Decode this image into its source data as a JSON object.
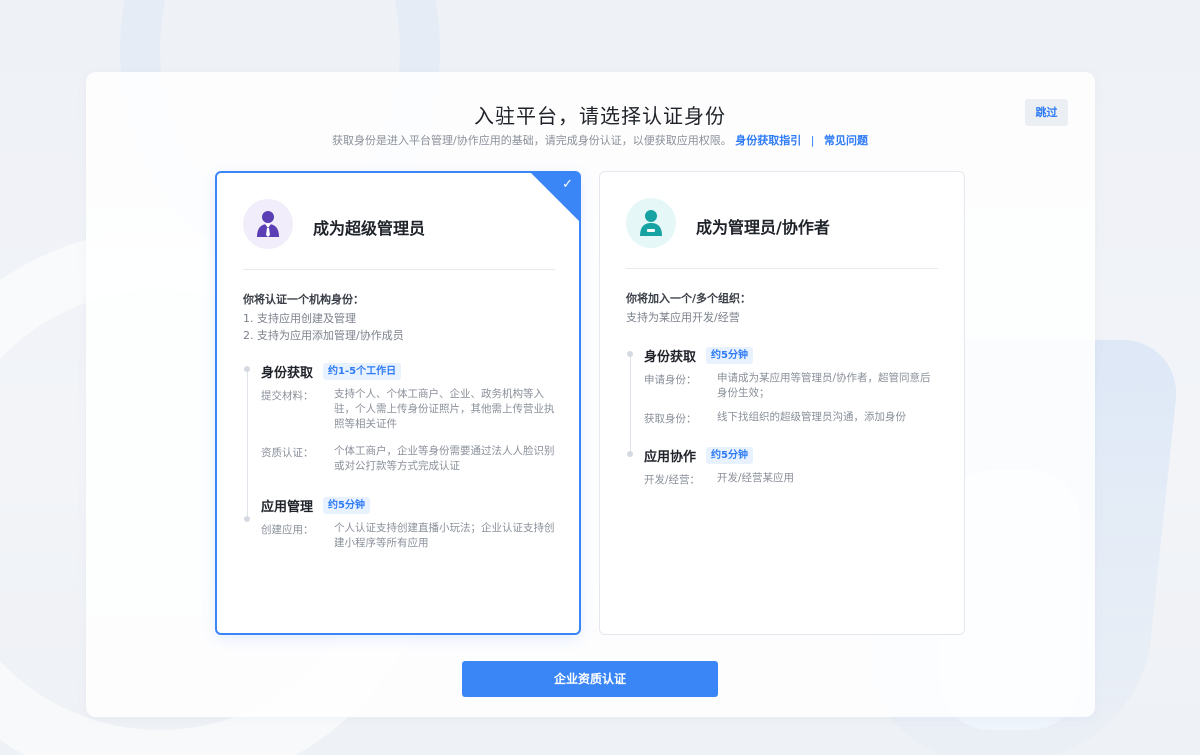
{
  "header": {
    "title": "入驻平台，请选择认证身份",
    "subtitle": "获取身份是进入平台管理/协作应用的基础，请完成身份认证，以便获取应用权限。",
    "guide_link": "身份获取指引",
    "separator": "|",
    "faq_link": "常见问题",
    "skip_label": "跳过"
  },
  "cards": [
    {
      "title": "成为超级管理员",
      "selected": true,
      "intro_head": "你将认证一个机构身份：",
      "intro_lines": [
        "1. 支持应用创建及管理",
        "2. 支持为应用添加管理/协作成员"
      ],
      "sections": [
        {
          "title": "身份获取",
          "badge": "约1-5个工作日",
          "rows": [
            {
              "key": "提交材料：",
              "value": "支持个人、个体工商户、企业、政务机构等入驻，个人需上传身份证照片，其他需上传营业执照等相关证件"
            },
            {
              "key": "资质认证：",
              "value": "个体工商户，企业等身份需要通过法人人脸识别或对公打款等方式完成认证"
            }
          ]
        },
        {
          "title": "应用管理",
          "badge": "约5分钟",
          "rows": [
            {
              "key": "创建应用：",
              "value": "个人认证支持创建直播小玩法；企业认证支持创建小程序等所有应用"
            }
          ]
        }
      ]
    },
    {
      "title": "成为管理员/协作者",
      "selected": false,
      "intro_head": "你将加入一个/多个组织：",
      "intro_lines": [
        "支持为某应用开发/经营"
      ],
      "sections": [
        {
          "title": "身份获取",
          "badge": "约5分钟",
          "rows": [
            {
              "key": "申请身份：",
              "value": "申请成为某应用等管理员/协作者，超管同意后身份生效；"
            },
            {
              "key": "获取身份：",
              "value": "线下找组织的超级管理员沟通，添加身份"
            }
          ]
        },
        {
          "title": "应用协作",
          "badge": "约5分钟",
          "rows": [
            {
              "key": "开发/经营：",
              "value": "开发/经营某应用"
            }
          ]
        }
      ]
    }
  ],
  "footer": {
    "submit_label": "企业资质认证"
  },
  "colors": {
    "primary": "#3b86f7",
    "badge_bg": "#e8f1fe",
    "avatar_purple": "#5b3fb4",
    "avatar_teal": "#17a3a3"
  },
  "icons": {
    "check": "checkmark-icon",
    "super_admin": "person-tie-icon",
    "collaborator": "person-badge-icon"
  }
}
